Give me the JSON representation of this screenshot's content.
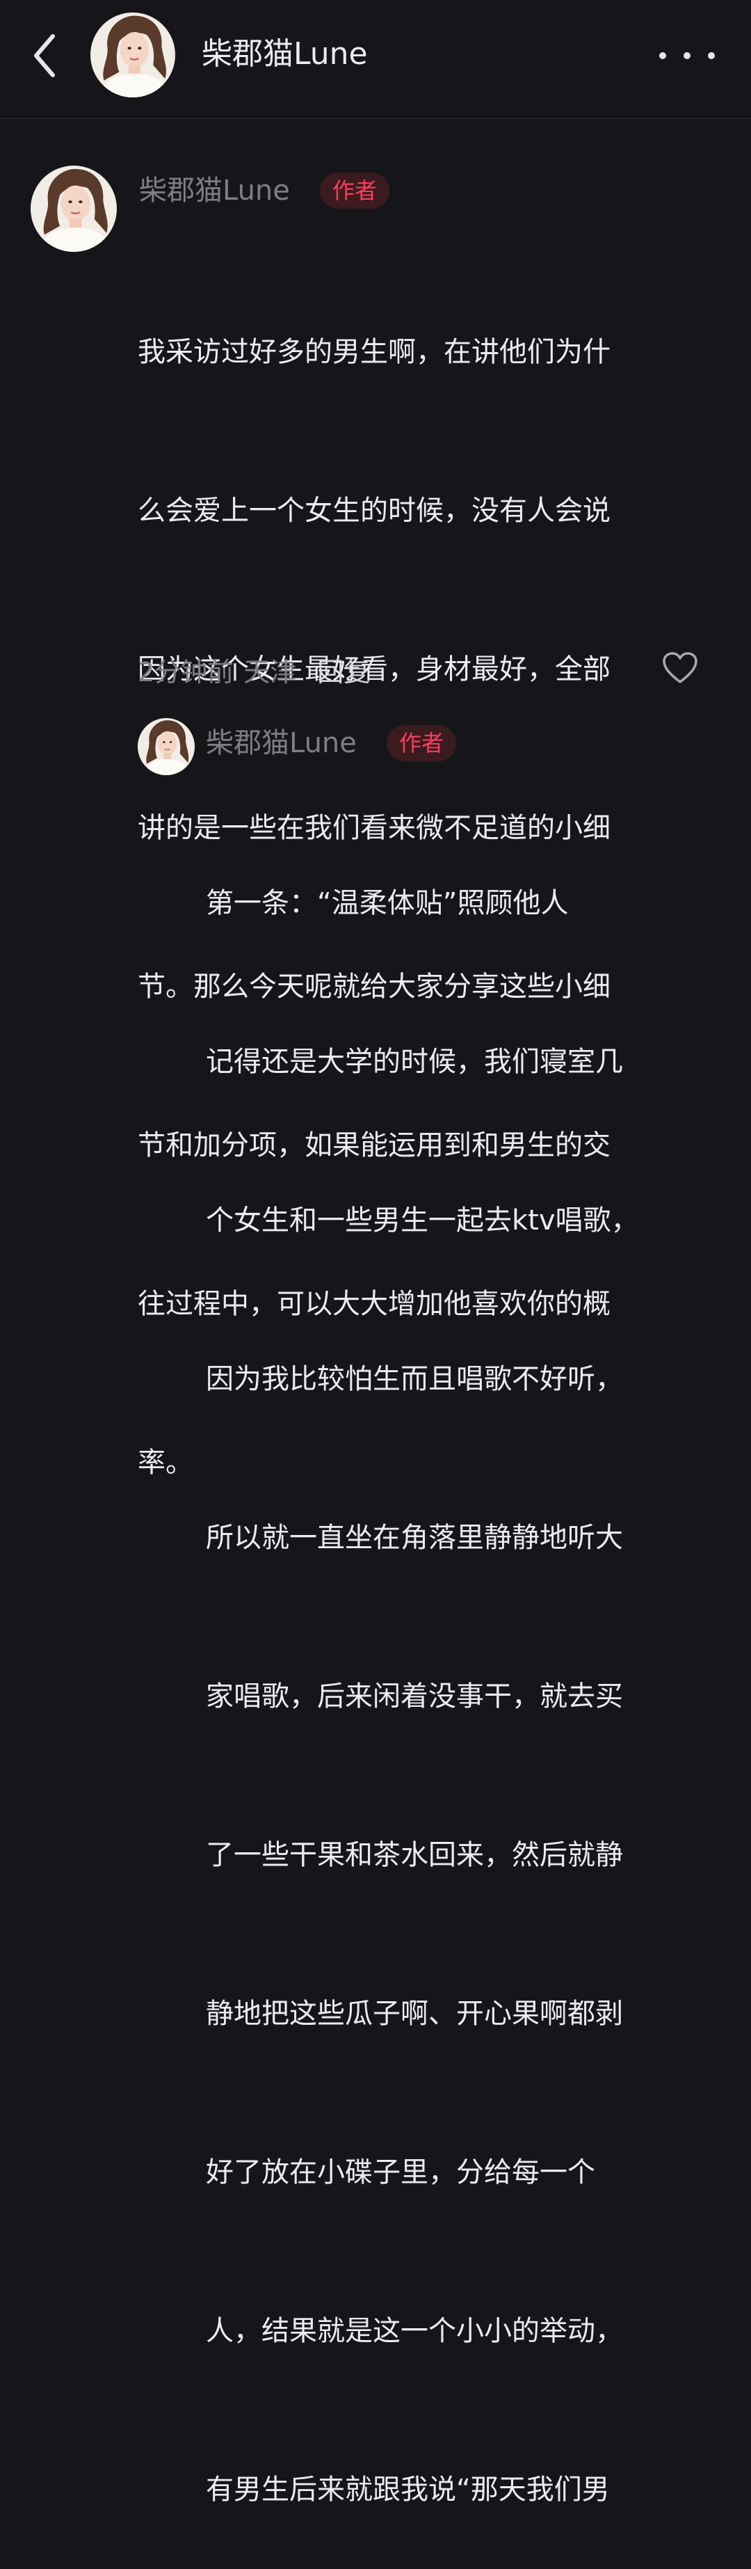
{
  "header": {
    "title": "柴郡猫Lune",
    "back_icon": "chevron-left-icon",
    "more_icon": "more-dots-icon"
  },
  "comment": {
    "author": "柴郡猫Lune",
    "badge": "作者",
    "lines": [
      "我采访过好多的男生啊，在讲他们为什",
      "么会爱上一个女生的时候，没有人会说",
      "因为这个女生最好看，身材最好，全部",
      "讲的是一些在我们看来微不足道的小细",
      "节。那么今天呢就给大家分享这些小细",
      "节和加分项，如果能运用到和男生的交",
      "往过程中，可以大大增加他喜欢你的概",
      "率。"
    ],
    "time": "2分钟前",
    "location": "天津",
    "reply_label": "回复",
    "like_icon": "heart-outline-icon"
  },
  "reply": {
    "author": "柴郡猫Lune",
    "badge": "作者",
    "lines": [
      "第一条：“温柔体贴”照顾他人",
      "记得还是大学的时候，我们寝室几",
      "个女生和一些男生一起去ktv唱歌，",
      "因为我比较怕生而且唱歌不好听，",
      "所以就一直坐在角落里静静地听大",
      "家唱歌，后来闲着没事干，就去买",
      "了一些干果和茶水回来，然后就静",
      "静地把这些瓜子啊、开心果啊都剥",
      "好了放在小碟子里，分给每一个",
      "人，结果就是这一个小小的举动，",
      "有男生后来就跟我说“那天我们男"
    ]
  },
  "colors": {
    "background": "#16161a",
    "text": "#ececef",
    "muted": "#7d7d84",
    "badge_text": "#ff3b5c",
    "badge_bg": "#3a1b20"
  }
}
